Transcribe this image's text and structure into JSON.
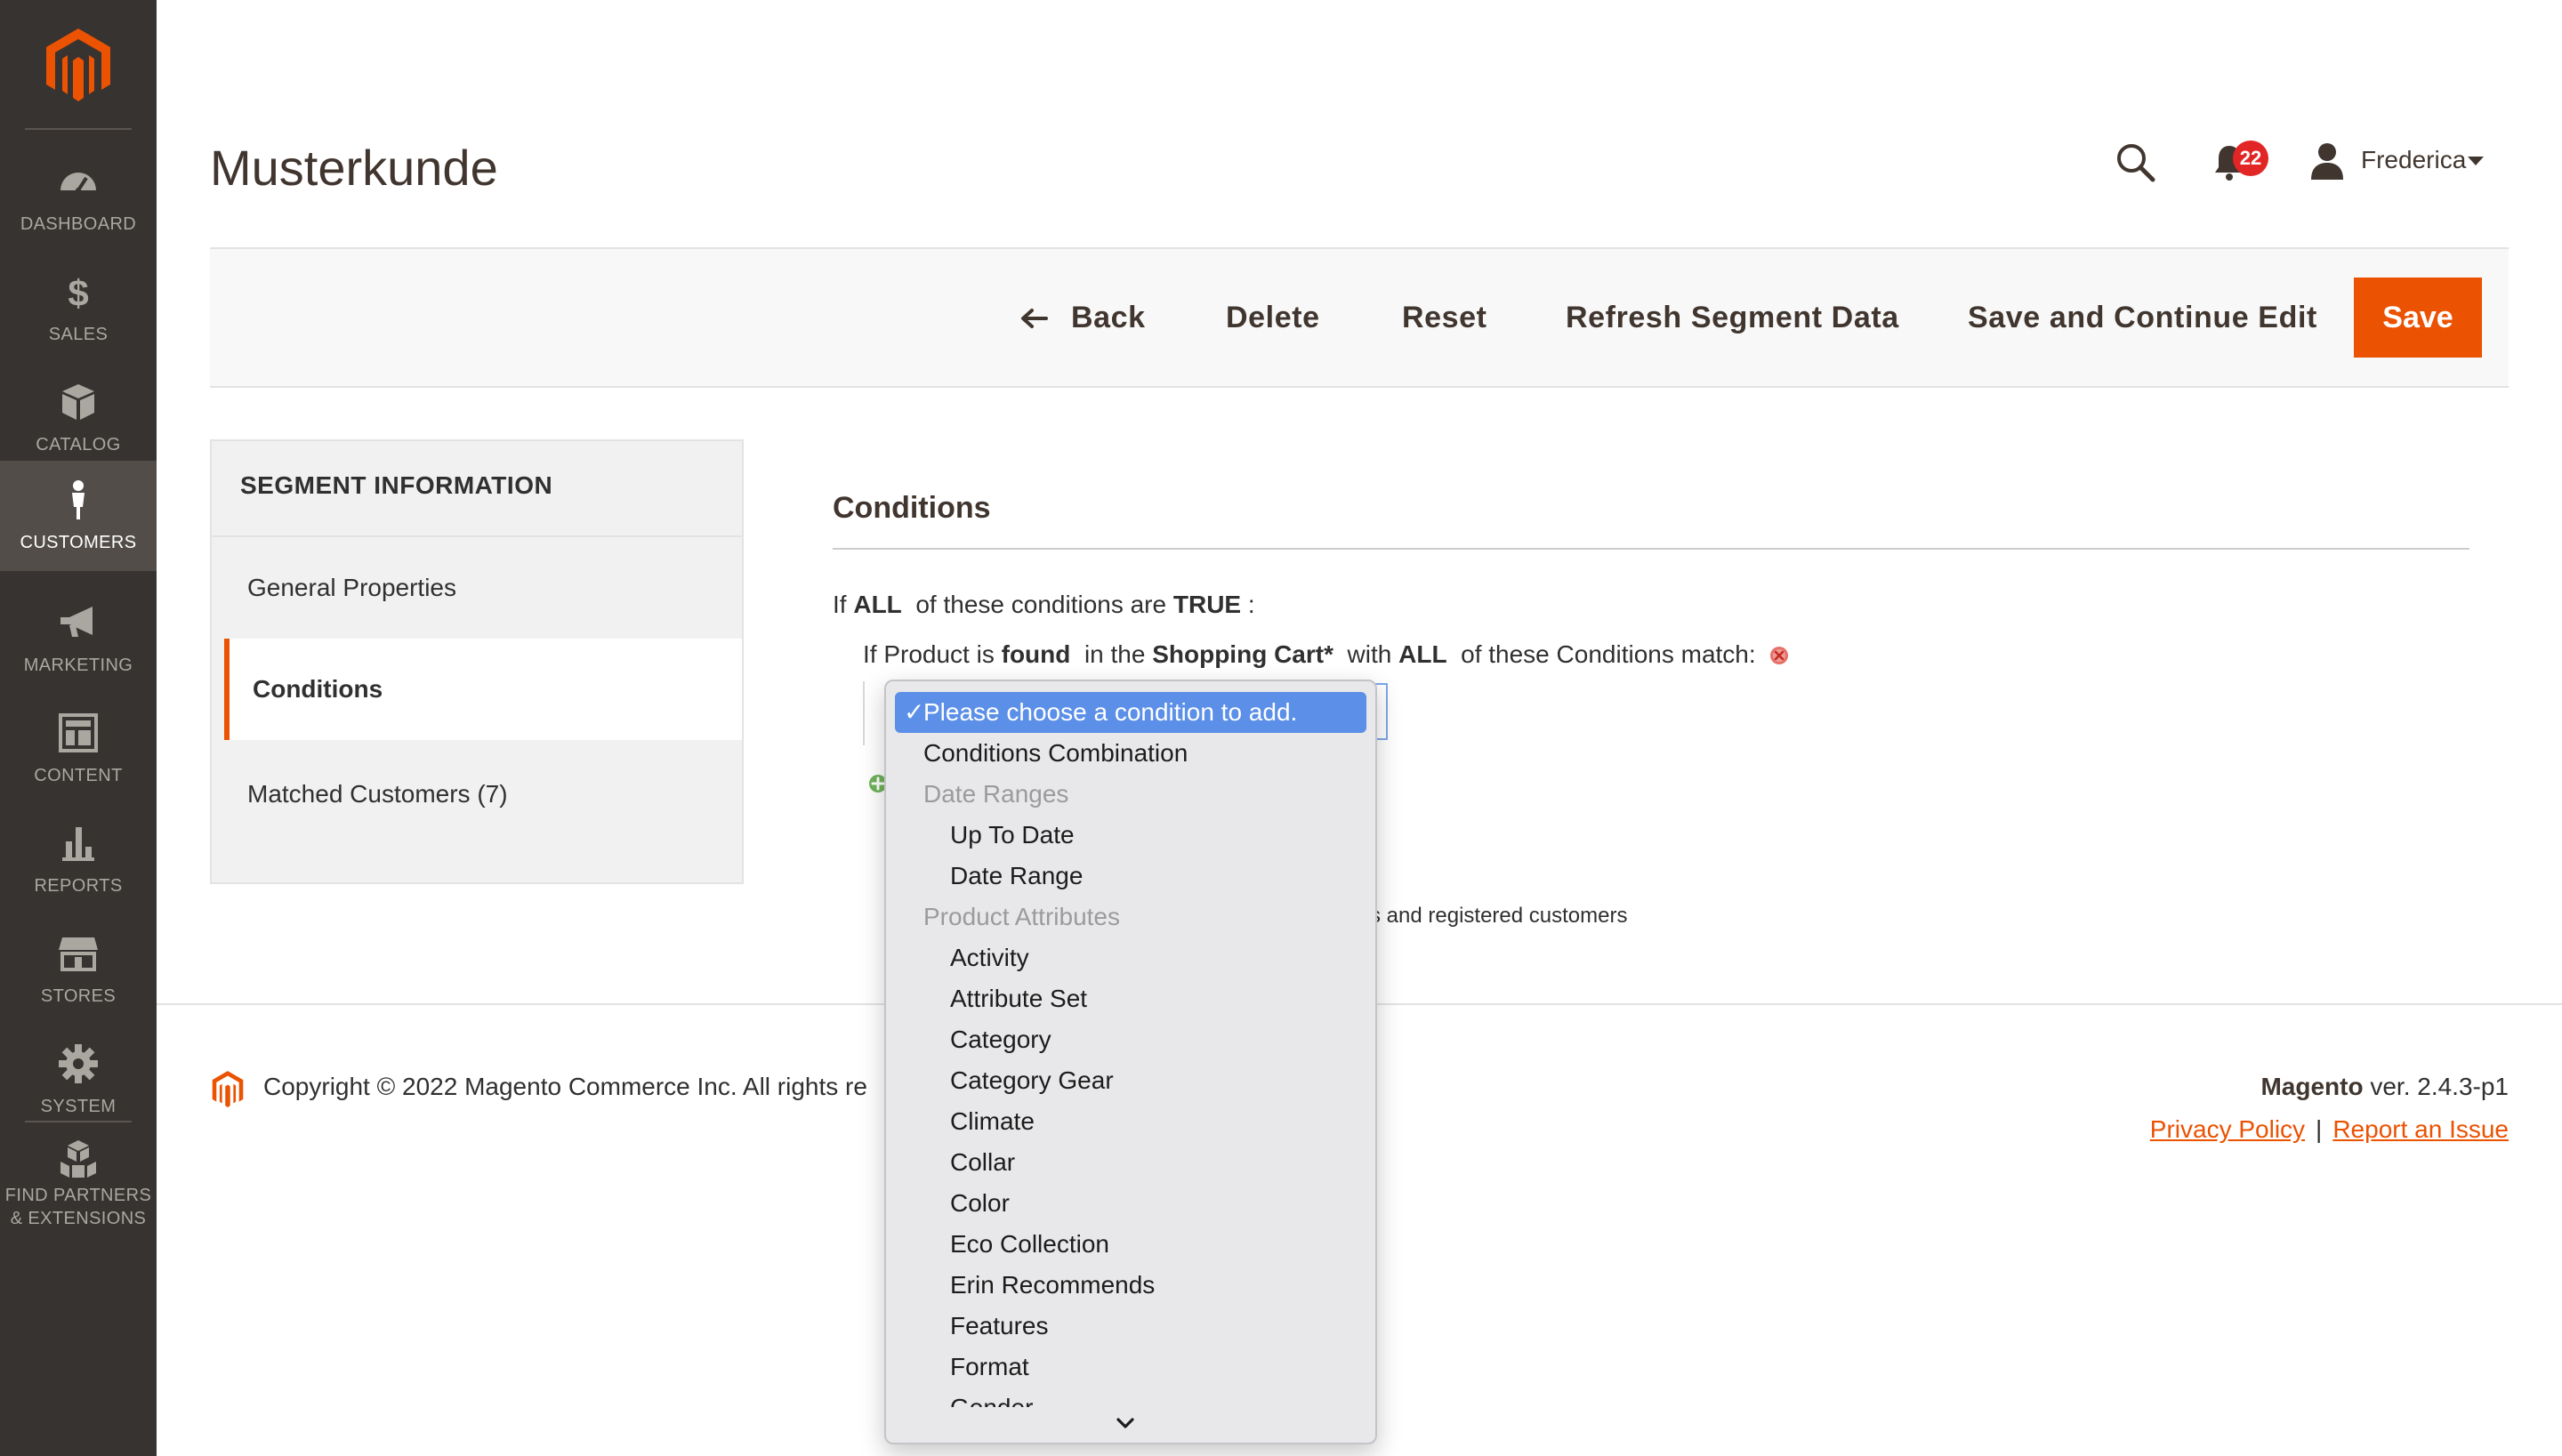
{
  "sidebar": {
    "items": [
      {
        "label": "DASHBOARD",
        "icon": "dashboard-icon"
      },
      {
        "label": "SALES",
        "icon": "dollar-icon"
      },
      {
        "label": "CATALOG",
        "icon": "box-icon"
      },
      {
        "label": "CUSTOMERS",
        "icon": "person-icon"
      },
      {
        "label": "MARKETING",
        "icon": "megaphone-icon"
      },
      {
        "label": "CONTENT",
        "icon": "layout-icon"
      },
      {
        "label": "REPORTS",
        "icon": "bar-chart-icon"
      },
      {
        "label": "STORES",
        "icon": "storefront-icon"
      },
      {
        "label": "SYSTEM",
        "icon": "gear-icon"
      }
    ],
    "partners": {
      "line1": "FIND PARTNERS",
      "line2": "& EXTENSIONS",
      "icon": "cubes-icon"
    },
    "active": "CUSTOMERS"
  },
  "header": {
    "title": "Musterkunde",
    "notifications_count": "22",
    "user_name": "Frederica"
  },
  "actions": {
    "back": "Back",
    "delete": "Delete",
    "reset": "Reset",
    "refresh": "Refresh Segment Data",
    "save_continue": "Save and Continue Edit",
    "save": "Save"
  },
  "tabs": {
    "title": "SEGMENT INFORMATION",
    "items": [
      "General Properties",
      "Conditions",
      "Matched Customers (7)"
    ],
    "active": "Conditions"
  },
  "conditions": {
    "title": "Conditions",
    "line1": {
      "if": "If",
      "aggregator": "ALL",
      "middle": "of these conditions are",
      "value": "TRUE",
      "end": ":"
    },
    "line2": {
      "prefix": "If Product is",
      "found": "found",
      "in_the": "in the",
      "cart": "Shopping Cart*",
      "with": "with",
      "aggregator": "ALL",
      "suffix": "of these Conditions match:"
    },
    "hidden_note": "s and registered customers"
  },
  "dropdown": {
    "selected": "Please choose a condition to add.",
    "options": [
      {
        "text": "Conditions Combination",
        "type": "option"
      },
      {
        "text": "Date Ranges",
        "type": "group"
      },
      {
        "text": "Up To Date",
        "type": "indent"
      },
      {
        "text": "Date Range",
        "type": "indent"
      },
      {
        "text": "Product Attributes",
        "type": "group"
      },
      {
        "text": "Activity",
        "type": "indent"
      },
      {
        "text": "Attribute Set",
        "type": "indent"
      },
      {
        "text": "Category",
        "type": "indent"
      },
      {
        "text": "Category Gear",
        "type": "indent"
      },
      {
        "text": "Climate",
        "type": "indent"
      },
      {
        "text": "Collar",
        "type": "indent"
      },
      {
        "text": "Color",
        "type": "indent"
      },
      {
        "text": "Eco Collection",
        "type": "indent"
      },
      {
        "text": "Erin Recommends",
        "type": "indent"
      },
      {
        "text": "Features",
        "type": "indent"
      },
      {
        "text": "Format",
        "type": "indent"
      },
      {
        "text": "Gender",
        "type": "indent"
      }
    ]
  },
  "footer": {
    "copyright": "Copyright © 2022 Magento Commerce Inc. All rights re",
    "brand": "Magento",
    "version": "ver. 2.4.3-p1",
    "privacy": "Privacy Policy",
    "separator": "|",
    "report": "Report an Issue"
  },
  "colors": {
    "sidebar_bg": "#373330",
    "accent": "#eb5202",
    "select_highlight": "#5b8fe8",
    "badge": "#e22626"
  }
}
